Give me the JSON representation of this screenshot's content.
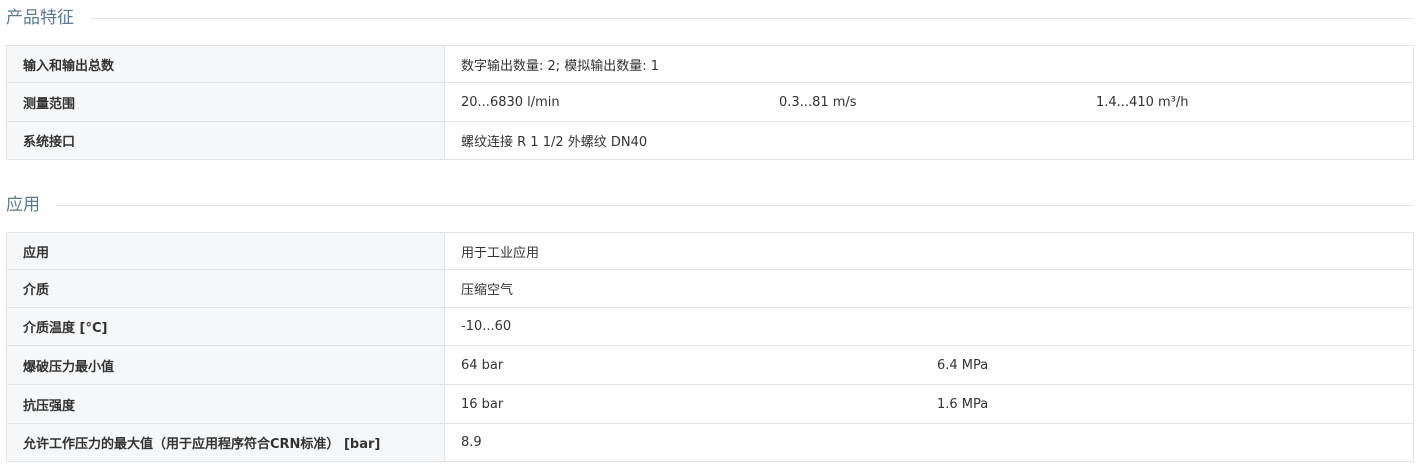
{
  "features": {
    "title": "产品特征",
    "rows": [
      {
        "label": "输入和输出总数",
        "values": [
          "数字输出数量: 2; 模拟输出数量: 1"
        ]
      },
      {
        "label": "测量范围",
        "values": [
          "20...6830 l/min",
          "0.3...81 m/s",
          "1.4...410 m³/h"
        ]
      },
      {
        "label": "系统接口",
        "values": [
          "螺纹连接 R 1 1/2 外螺纹 DN40"
        ]
      }
    ]
  },
  "application": {
    "title": "应用",
    "rows": [
      {
        "label": "应用",
        "values": [
          "用于工业应用"
        ]
      },
      {
        "label": "介质",
        "values": [
          "压缩空气"
        ]
      },
      {
        "label": "介质温度 [°C]",
        "values": [
          "-10...60"
        ]
      },
      {
        "label": "爆破压力最小值",
        "values": [
          "64 bar",
          "6.4 MPa"
        ]
      },
      {
        "label": "抗压强度",
        "values": [
          "16 bar",
          "1.6 MPa"
        ]
      },
      {
        "label": "允许工作压力的最大值（用于应用程序符合CRN标准） [bar]",
        "values": [
          "8.9"
        ]
      }
    ]
  }
}
